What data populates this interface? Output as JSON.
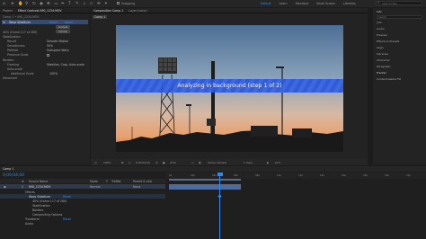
{
  "workspaces": {
    "items": [
      "Default",
      "Learn",
      "Standard",
      "Small Screen",
      "Libraries"
    ],
    "active_index": 0
  },
  "top_icons": [
    "home-icon",
    "select-tool-icon",
    "hand-tool-icon",
    "zoom-tool-icon",
    "rotate-tool-icon",
    "camera-tool-icon",
    "pan-behind-icon",
    "rectangle-tool-icon",
    "pen-tool-icon",
    "type-tool-icon",
    "brush-tool-icon",
    "clone-stamp-icon",
    "eraser-icon",
    "roto-brush-icon",
    "puppet-pin-icon"
  ],
  "snapping_label": "Snapping",
  "search_placeholder": "Search Help",
  "project": {
    "tabs": [
      "Project",
      "Effect Controls  IMG_1234.MOV",
      "Composition"
    ],
    "active_tab": 1,
    "layer_header": "Comp 1 • IMG_1234.MOV",
    "effect_name": "Warp Stabilizer",
    "reset_label": "Reset",
    "about_label": "About",
    "analyze_label": "Analyze",
    "cancel_label": "Cancel",
    "rows": [
      {
        "label": "Analyze",
        "value": ""
      },
      {
        "label": "40% (frame 117 of 289)",
        "value": ""
      },
      {
        "label": "Stabilization",
        "value": ""
      },
      {
        "label": "Result",
        "value": "Smooth Motion"
      },
      {
        "label": "Smoothness",
        "value": "50%"
      },
      {
        "label": "Method",
        "value": "Subspace Warp"
      },
      {
        "label": "Preserve Scale",
        "value": ""
      },
      {
        "label": "Borders",
        "value": ""
      },
      {
        "label": "Framing",
        "value": "Stabilize, Crop, Auto-scale"
      },
      {
        "label": "Auto-scale",
        "value": ""
      },
      {
        "label": "Additional Scale",
        "value": "100%"
      },
      {
        "label": "Advanced",
        "value": ""
      }
    ]
  },
  "composition": {
    "tabs": [
      "Composition  Comp 1",
      "Layer  (none)"
    ],
    "breadcrumb": "Comp 1",
    "banner_text": "Analyzing in background (step 1 of 2)"
  },
  "right_panel": {
    "title": "Info",
    "search_placeholder": "Search",
    "items": [
      "Info",
      "Audio",
      "Preview",
      "Effects & Presets",
      "Align",
      "Libraries",
      "Character",
      "Paragraph",
      "Tracker",
      "Content-Aware Fill"
    ]
  },
  "viewer_footer": {
    "zoom": "100%",
    "timecode": "0;00;04;00",
    "resolution": "(Full)",
    "camera": "Active Camera",
    "views": "1 View",
    "exposure": "+0.0"
  },
  "timeline": {
    "tab": "Comp 1",
    "timecode": "0;00;04;00",
    "header_cols": [
      "#",
      "Source Name",
      "Mode",
      "T",
      "TrkMat",
      "Parent & Link"
    ],
    "layer": {
      "index": "1",
      "name": "IMG_1234.MOV",
      "mode": "Normal",
      "parent": "None"
    },
    "sub_rows": [
      {
        "label": "Effects",
        "value": ""
      },
      {
        "label": "Warp Stabilizer",
        "value": "Reset"
      },
      {
        "label": "40% (frame 117 of 289)",
        "value": ""
      },
      {
        "label": "Stabilization",
        "value": ""
      },
      {
        "label": "Borders",
        "value": ""
      },
      {
        "label": "Compositing Options",
        "value": ""
      },
      {
        "label": "Transform",
        "value": "Reset"
      },
      {
        "label": "Audio",
        "value": ""
      }
    ],
    "ruler_ticks": [
      "0s",
      "02s",
      "04s",
      "06s",
      "08s",
      "10s",
      "12s",
      "14s",
      "16s",
      "18s",
      "20s",
      "22s"
    ],
    "playhead_seconds": 4
  },
  "colors": {
    "accent": "#2d8ceb",
    "panel": "#232323",
    "banner": "#2b55d6"
  }
}
